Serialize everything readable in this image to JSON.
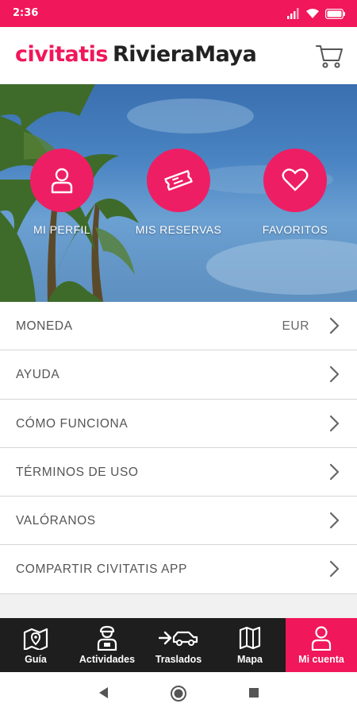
{
  "status_bar": {
    "time": "2:36",
    "color": "#f0175a"
  },
  "header": {
    "brand": "civitatis",
    "destination": "RivieraMaya",
    "cart_icon": "cart-icon"
  },
  "hero": {
    "tiles": [
      {
        "label": "MI PERFIL",
        "icon": "user-icon"
      },
      {
        "label": "MIS RESERVAS",
        "icon": "ticket-icon"
      },
      {
        "label": "FAVORITOS",
        "icon": "heart-icon"
      }
    ]
  },
  "menu": {
    "items": [
      {
        "label": "MONEDA",
        "value": "EUR"
      },
      {
        "label": "AYUDA"
      },
      {
        "label": "CÓMO FUNCIONA"
      },
      {
        "label": "TÉRMINOS DE USO"
      },
      {
        "label": "VALÓRANOS"
      },
      {
        "label": "COMPARTIR CIVITATIS APP"
      }
    ]
  },
  "bottom_nav": {
    "items": [
      {
        "label": "Guía",
        "icon": "map-pin-book-icon"
      },
      {
        "label": "Actividades",
        "icon": "guide-person-icon"
      },
      {
        "label": "Traslados",
        "icon": "car-transfer-icon"
      },
      {
        "label": "Mapa",
        "icon": "map-icon"
      },
      {
        "label": "Mi cuenta",
        "icon": "user-icon",
        "active": true
      }
    ],
    "active_color": "#f0175a"
  },
  "system_nav": {
    "back": "back-icon",
    "home": "home-icon",
    "recents": "recents-icon"
  }
}
